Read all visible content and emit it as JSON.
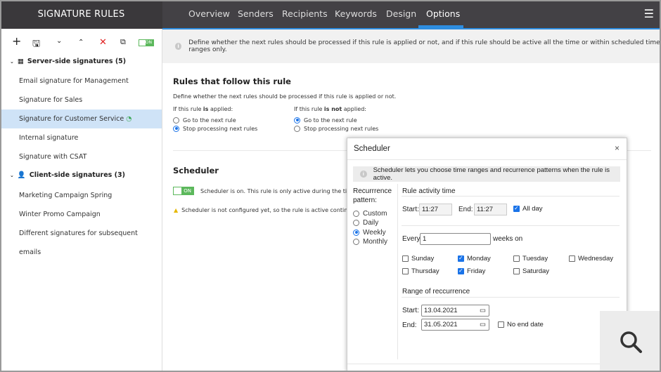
{
  "sidebar": {
    "title": "SIGNATURE RULES",
    "toolbar": {
      "toggle_label": "ON"
    },
    "groups": [
      {
        "label": "Server-side signatures (5)",
        "items": [
          "Email signature for Management",
          "Signature for Sales",
          "Signature for Customer Service",
          "Internal signature",
          "Signature with CSAT"
        ]
      },
      {
        "label": "Client-side signatures (3)",
        "items": [
          "Marketing Campaign Spring",
          "Winter Promo Campaign",
          "Different signatures for subsequent emails"
        ]
      }
    ],
    "selected": "Signature for Customer Service"
  },
  "tabs": [
    "Overview",
    "Senders",
    "Recipients",
    "Keywords",
    "Design",
    "Options"
  ],
  "active_tab": "Options",
  "info": "Define whether the next rules should be processed if this rule is applied or not, and if this rule should be active all the time or within scheduled time ranges only.",
  "rules": {
    "title": "Rules that follow this rule",
    "desc": "Define whether the next rules should be processed if this rule is applied or not.",
    "applied_pre": "If this rule ",
    "applied_bold": "is",
    "applied_post": " applied:",
    "notapplied_pre": "If this rule ",
    "notapplied_bold": "is not",
    "notapplied_post": " applied:",
    "opt_next": "Go to the next rule",
    "opt_stop": "Stop processing next rules",
    "applied_selected": "Stop processing next rules",
    "notapplied_selected": "Go to the next rule"
  },
  "scheduler": {
    "title": "Scheduler",
    "toggle": "ON",
    "status": "Scheduler is on. This rule is only active during the time ranges",
    "warning": "Scheduler is not configured yet, so the rule is active continuously and"
  },
  "dialog": {
    "title": "Scheduler",
    "info": "Scheduler lets you choose time ranges and recurrence patterns when the rule is active.",
    "pattern_label": "Recurrrence pattern:",
    "patterns": [
      "Custom",
      "Daily",
      "Weekly",
      "Monthly"
    ],
    "pattern_selected": "Weekly",
    "activity_title": "Rule activity time",
    "start_label": "Start:",
    "start": "11:27",
    "end_label": "End:",
    "end": "11:27",
    "allday_label": "All day",
    "allday": true,
    "every_label": "Every",
    "every": "1",
    "weeks_on": "weeks on",
    "days": [
      {
        "name": "Sunday",
        "checked": false
      },
      {
        "name": "Monday",
        "checked": true
      },
      {
        "name": "Tuesday",
        "checked": false
      },
      {
        "name": "Wednesday",
        "checked": false
      },
      {
        "name": "Thursday",
        "checked": false
      },
      {
        "name": "Friday",
        "checked": true
      },
      {
        "name": "Saturday",
        "checked": false
      }
    ],
    "range_title": "Range of reccurrence",
    "range_start_label": "Start:",
    "range_start": "13.04.2021",
    "range_end_label": "End:",
    "range_end": "31.05.2021",
    "no_end_label": "No end date",
    "no_end": false
  },
  "colors": {
    "accent": "#2e8de0",
    "header": "#434145",
    "selected": "#cfe3f7",
    "toggle": "#5cb85c"
  }
}
